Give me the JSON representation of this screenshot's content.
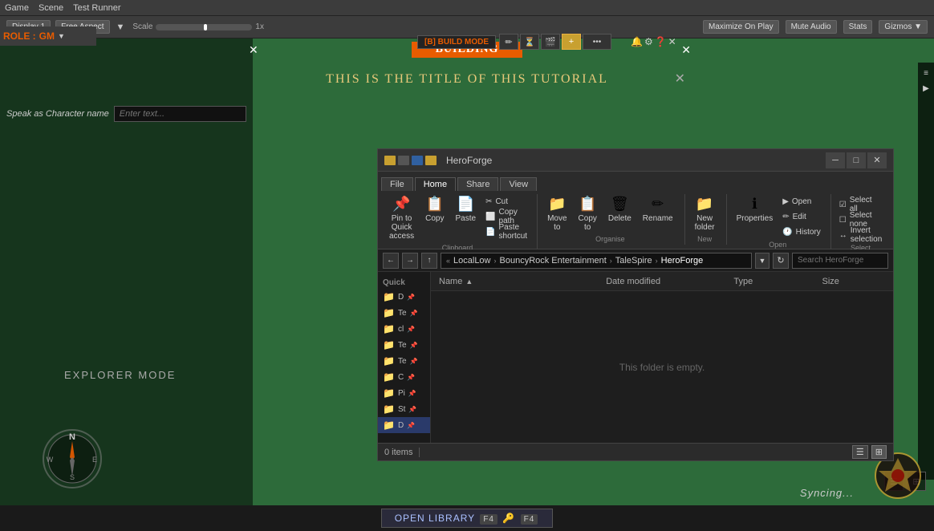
{
  "unityTopBar": {
    "items": [
      "Game",
      "Scene",
      "Test Runner"
    ]
  },
  "unityToolbar": {
    "display": "Display 1",
    "aspect": "Free Aspect",
    "scale": "Scale",
    "scaleValue": "1x",
    "rightItems": [
      "Maximize On Play",
      "Mute Audio",
      "Stats",
      "Gizmos ▼"
    ]
  },
  "buildmodeBar": {
    "logo": "[B] BUILD MODE"
  },
  "role": {
    "label": "ROLE :",
    "value": "GM"
  },
  "buildingBar": {
    "label": "Building",
    "closeLeft": "✕",
    "closeRight": "✕"
  },
  "titleBar": {
    "text": "This is the title of this tutorial",
    "close": "✕"
  },
  "speakAs": {
    "label": "Speak as Character name",
    "placeholder": "Enter text..."
  },
  "explorerMode": {
    "text": "Explorer mode"
  },
  "fileExplorer": {
    "title": "HeroForge",
    "windowControls": {
      "minimize": "─",
      "maximize": "□",
      "close": "✕"
    },
    "tabs": [
      "File",
      "Home",
      "Share",
      "View"
    ],
    "activeTab": "Home",
    "ribbon": {
      "clipboard": {
        "label": "Clipboard",
        "buttons": [
          {
            "label": "Pin to Quick\naccess",
            "icon": "📌"
          },
          {
            "label": "Copy",
            "icon": "📋"
          },
          {
            "label": "Paste",
            "icon": "📄"
          }
        ],
        "smallButtons": [
          {
            "label": "✂ Cut"
          },
          {
            "label": "⬜ Copy path"
          },
          {
            "label": "📄 Paste shortcut"
          }
        ]
      },
      "organise": {
        "label": "Organise",
        "buttons": [
          {
            "label": "Move\nto",
            "icon": "📁"
          },
          {
            "label": "Copy\nto",
            "icon": "📋"
          },
          {
            "label": "Delete",
            "icon": "🗑"
          },
          {
            "label": "Rename",
            "icon": "✏"
          }
        ]
      },
      "new": {
        "label": "New",
        "buttons": [
          {
            "label": "New\nfolder",
            "icon": "📁"
          }
        ]
      },
      "open": {
        "label": "Open",
        "buttons": [
          {
            "label": "Properties",
            "icon": "ℹ"
          }
        ],
        "smallButtons": [
          {
            "label": "▶ Open"
          },
          {
            "label": "✏ Edit"
          },
          {
            "label": "🕐 History"
          }
        ]
      },
      "select": {
        "label": "Select",
        "buttons": [
          {
            "label": "Select all"
          },
          {
            "label": "Select none"
          },
          {
            "label": "Invert selection"
          }
        ]
      }
    },
    "addressBar": {
      "path": [
        "LocalLow",
        "BouncyRock Entertainment",
        "TaleSpire",
        "HeroForge"
      ],
      "searchPlaceholder": "Search HeroForge"
    },
    "columns": [
      "Name",
      "Date modified",
      "Type",
      "Size"
    ],
    "emptyMessage": "This folder is empty.",
    "statusBar": {
      "itemCount": "0 items",
      "divider": "|"
    }
  },
  "sidebar": {
    "quickAccessLabel": "Quick",
    "items": [
      {
        "label": "D",
        "pinned": true
      },
      {
        "label": "Te",
        "pinned": true
      },
      {
        "label": "cl",
        "pinned": true
      },
      {
        "label": "Te",
        "pinned": true
      },
      {
        "label": "Te",
        "pinned": true
      },
      {
        "label": "C",
        "pinned": true
      },
      {
        "label": "Pi",
        "pinned": true
      },
      {
        "label": "St",
        "pinned": true
      },
      {
        "label": "D",
        "pinned": true,
        "active": true
      }
    ]
  },
  "bottomBar": {
    "openLibrary": "Open Library",
    "key1": "F4",
    "key2": "F4"
  },
  "syncing": {
    "text": "Syncing..."
  }
}
